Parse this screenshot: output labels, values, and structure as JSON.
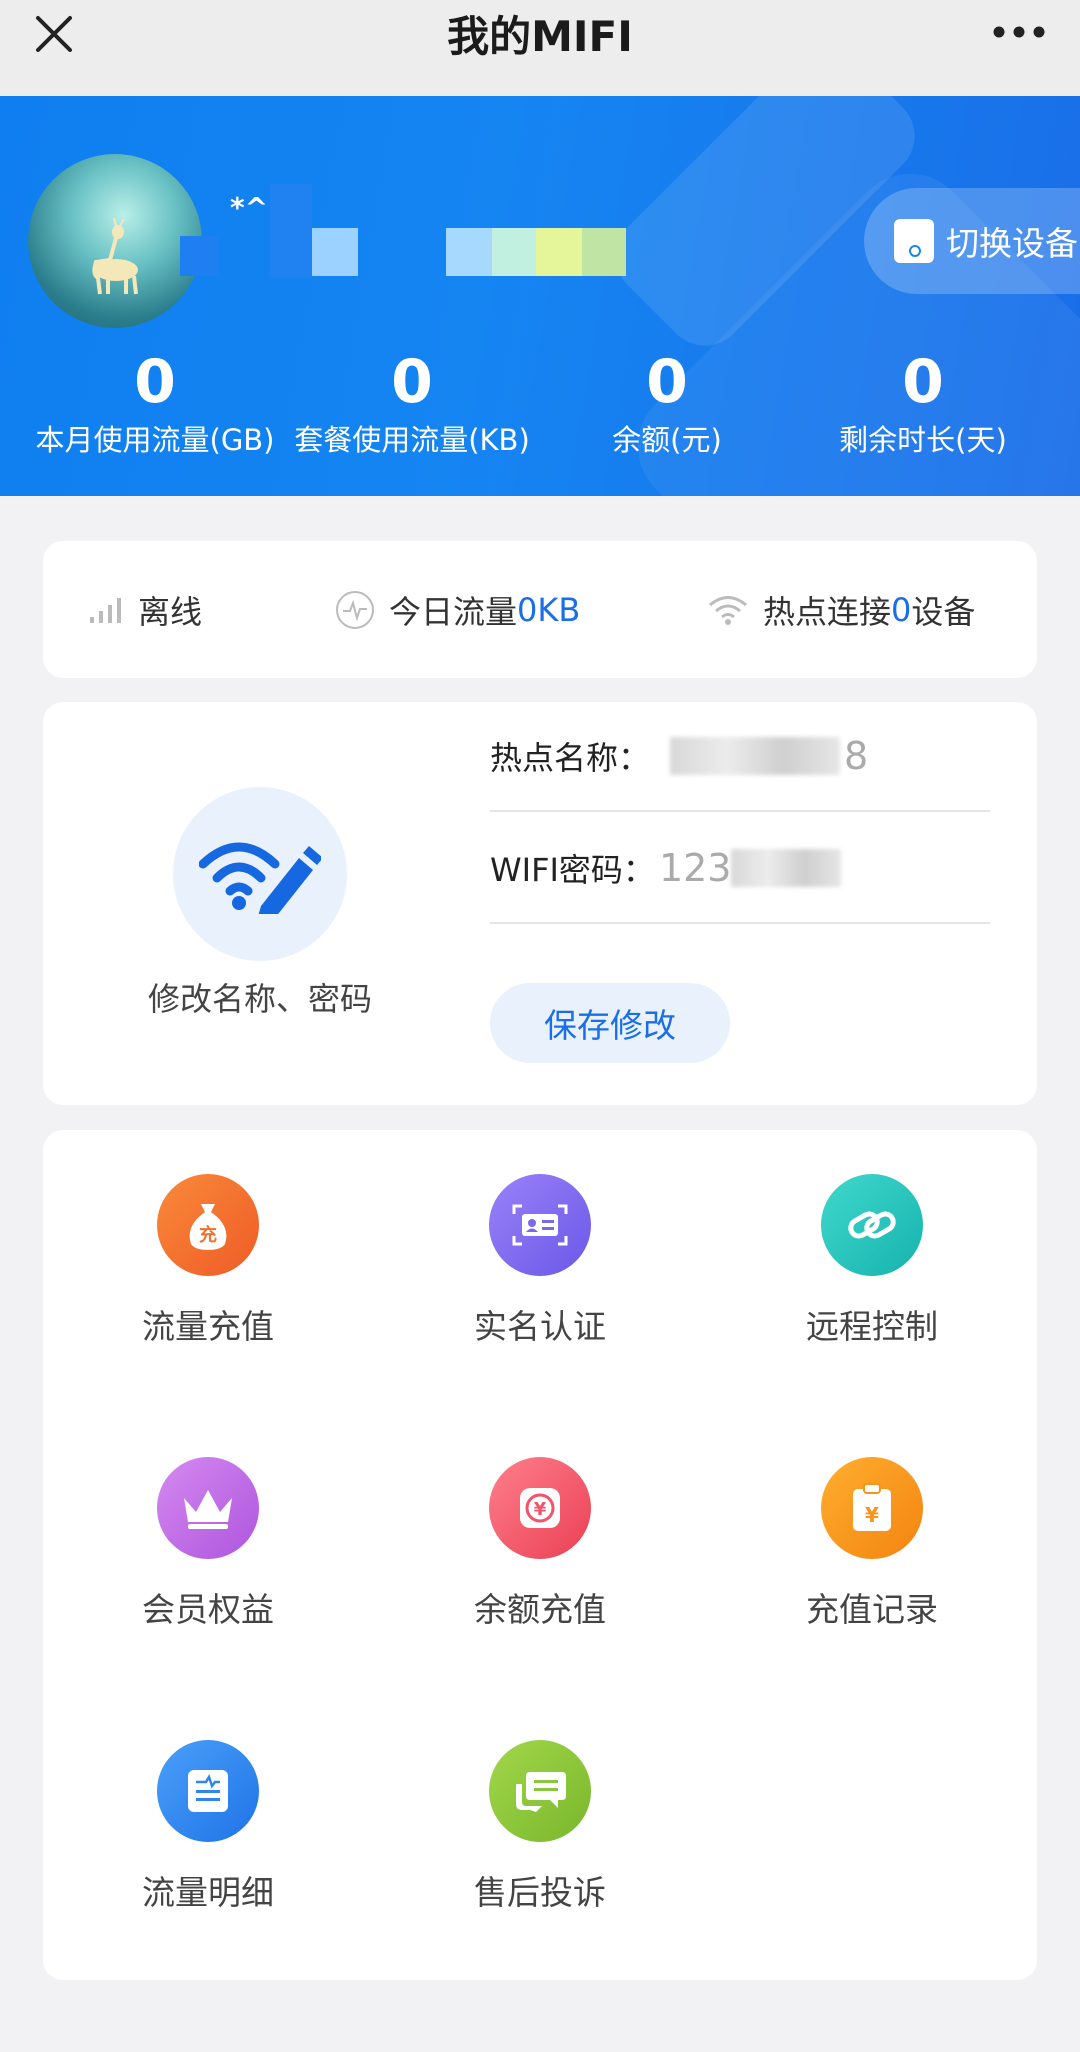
{
  "topbar": {
    "title": "我的MIFI",
    "close_icon": "close-icon",
    "more_icon": "more-icon"
  },
  "profile": {
    "username_prefix": "*^",
    "switch_label": "切换设备"
  },
  "stats": [
    {
      "value": "0",
      "label": "本月使用流量(GB)"
    },
    {
      "value": "0",
      "label": "套餐使用流量(KB)"
    },
    {
      "value": "0",
      "label": "余额(元)"
    },
    {
      "value": "0",
      "label": "剩余时长(天)"
    }
  ],
  "status": {
    "signal_text": "离线",
    "today_prefix": "今日流量",
    "today_value": "0KB",
    "hotspot_prefix": "热点连接",
    "hotspot_count": "0",
    "hotspot_suffix": "设备"
  },
  "wifi": {
    "edit_label": "修改名称、密码",
    "ssid_label": "热点名称：",
    "ssid_tail": "8",
    "password_label": "WIFI密码：",
    "password_head": "123",
    "save_label": "保存修改"
  },
  "menu": [
    {
      "label": "流量充值",
      "icon": "moneybag-icon",
      "color": "#f2702e"
    },
    {
      "label": "实名认证",
      "icon": "id-card-icon",
      "color": "#7b68f0"
    },
    {
      "label": "远程控制",
      "icon": "link-icon",
      "color": "#25c4be"
    },
    {
      "label": "会员权益",
      "icon": "crown-icon",
      "color": "#c46ee8"
    },
    {
      "label": "余额充值",
      "icon": "wallet-icon",
      "color": "#f0556a"
    },
    {
      "label": "充值记录",
      "icon": "receipt-icon",
      "color": "#f7941d"
    },
    {
      "label": "流量明细",
      "icon": "document-icon",
      "color": "#2e86f0"
    },
    {
      "label": "售后投诉",
      "icon": "chat-icon",
      "color": "#8cc63f"
    }
  ]
}
